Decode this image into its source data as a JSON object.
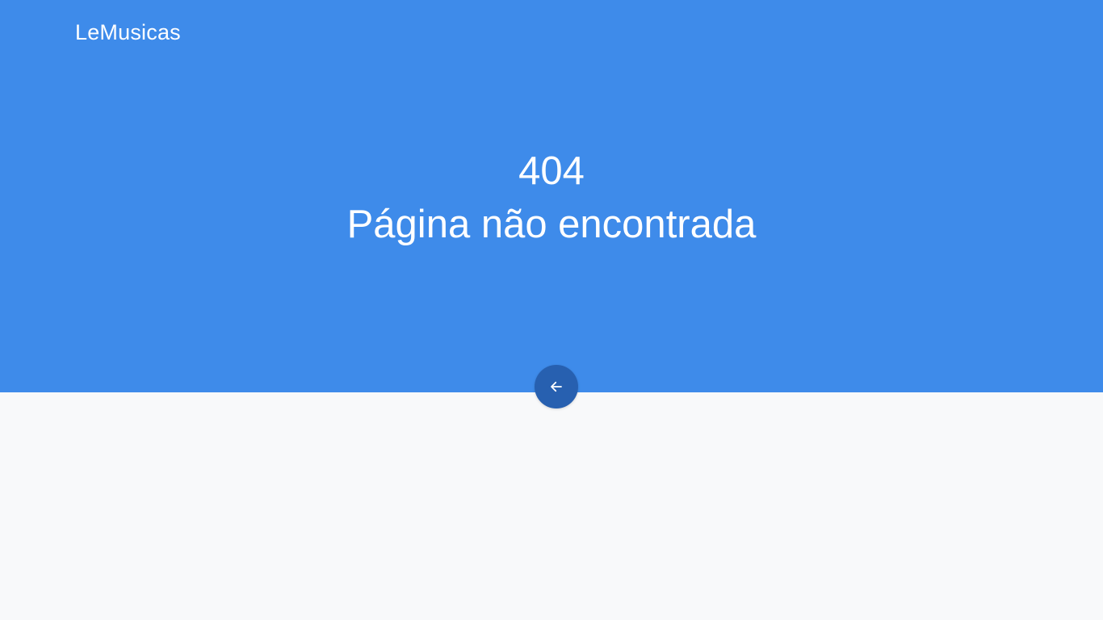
{
  "header": {
    "brand": "LeMusicas"
  },
  "error": {
    "code": "404",
    "message": "Página não encontrada"
  },
  "back_button": {
    "icon": "arrow-left-icon",
    "aria_label": "Voltar"
  },
  "colors": {
    "hero_background": "#3e8bea",
    "button_background": "#2760b0",
    "page_background": "#f8f9fa",
    "text": "#ffffff"
  }
}
